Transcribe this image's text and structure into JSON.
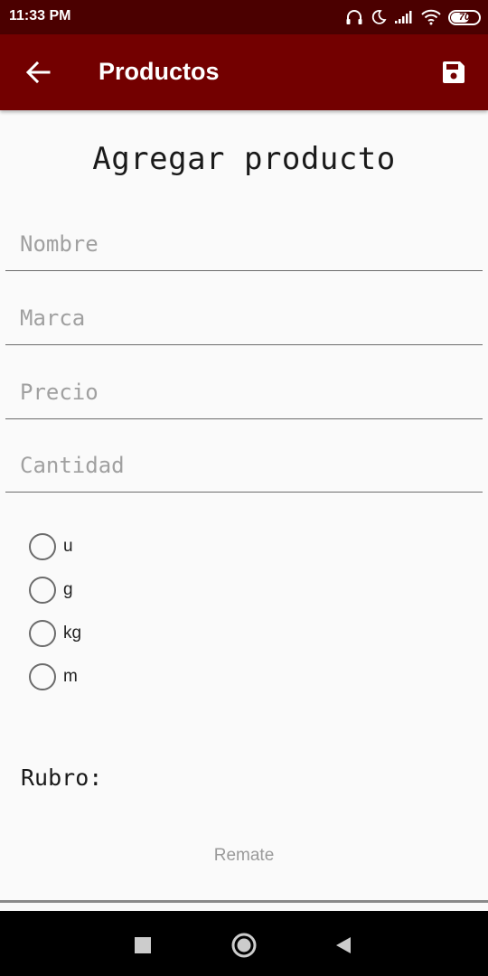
{
  "status_bar": {
    "time": "11:33 PM",
    "battery_level": "70",
    "icons": [
      "headphones-icon",
      "moon-icon",
      "signal-icon",
      "wifi-icon",
      "battery-icon"
    ]
  },
  "app_bar": {
    "title": "Productos",
    "back_icon": "arrow-left-icon",
    "save_icon": "floppy-disk-icon",
    "color": "#730000"
  },
  "form": {
    "heading": "Agregar producto",
    "fields": [
      {
        "placeholder": "Nombre",
        "value": ""
      },
      {
        "placeholder": "Marca",
        "value": ""
      },
      {
        "placeholder": "Precio",
        "value": ""
      },
      {
        "placeholder": "Cantidad",
        "value": ""
      }
    ],
    "units": [
      {
        "label": "u",
        "checked": false
      },
      {
        "label": "g",
        "checked": false
      },
      {
        "label": "kg",
        "checked": false
      },
      {
        "label": "m",
        "checked": false
      }
    ],
    "rubro_label": "Rubro:",
    "rubro_selected": "Remate"
  },
  "nav_bar": {
    "icons": [
      "recents-square-icon",
      "home-circle-icon",
      "back-triangle-icon"
    ]
  }
}
